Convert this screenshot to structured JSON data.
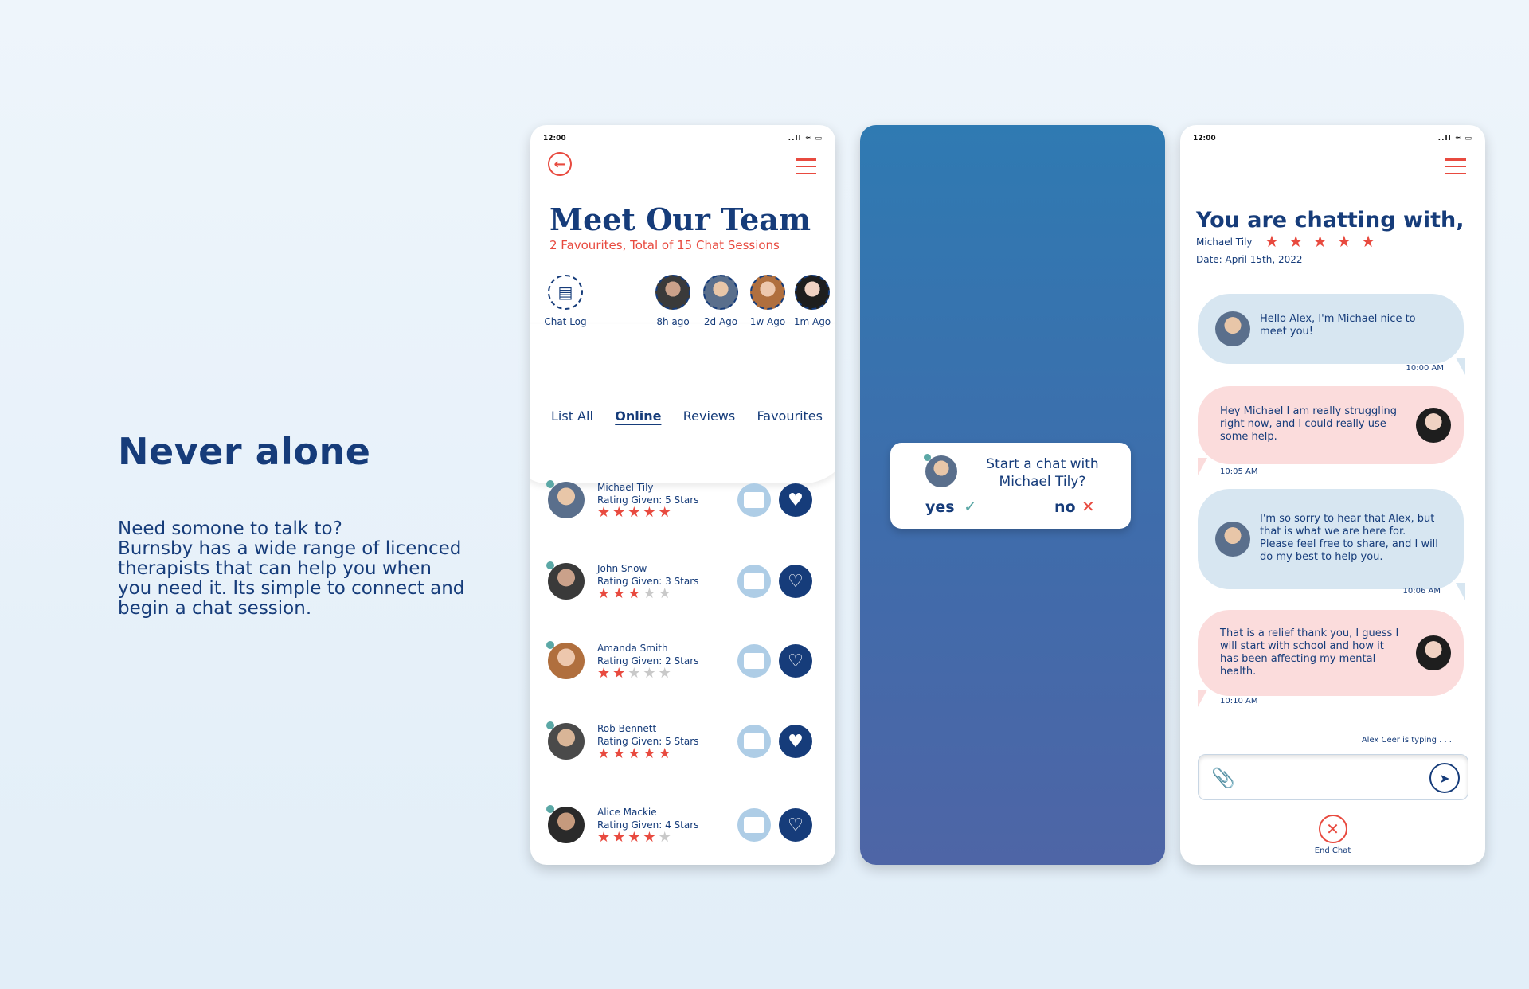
{
  "intro": {
    "heading": "Never alone",
    "body_lines": [
      "Need somone to talk to?",
      "Burnsby has a wide range of licenced",
      "therapists that can help you when",
      "you need it. Its simple to connect and",
      "begin a chat session."
    ]
  },
  "phone1": {
    "time": "12:00",
    "status_icons": "..ll ≈ ▭",
    "title": "Meet Our Team",
    "subtitle": "2 Favourites, Total of 15 Chat Sessions",
    "chat_log_label": "Chat Log",
    "recent": [
      {
        "label": "8h ago"
      },
      {
        "label": "2d Ago"
      },
      {
        "label": "1w Ago"
      },
      {
        "label": "1m Ago"
      }
    ],
    "tabs": [
      "List All",
      "Online",
      "Reviews",
      "Favourites"
    ],
    "active_tab": "Online",
    "therapists": [
      {
        "name": "Michael Tily",
        "rating": "Rating Given: 5 Stars",
        "stars": 5,
        "online": true,
        "favourite": true
      },
      {
        "name": "John Snow",
        "rating": "Rating Given: 3 Stars",
        "stars": 3,
        "online": true,
        "favourite": false
      },
      {
        "name": "Amanda Smith",
        "rating": "Rating Given: 2 Stars",
        "stars": 2,
        "online": true,
        "favourite": false
      },
      {
        "name": "Rob Bennett",
        "rating": "Rating Given: 5 Stars",
        "stars": 5,
        "online": true,
        "favourite": true
      },
      {
        "name": "Alice Mackie",
        "rating": "Rating Given: 4 Stars",
        "stars": 4,
        "online": true,
        "favourite": false
      }
    ]
  },
  "phone2": {
    "dialog_line1": "Start a chat with",
    "dialog_line2": "Michael Tily?",
    "yes_label": "yes",
    "no_label": "no"
  },
  "phone3": {
    "time": "12:00",
    "status_icons": "..ll ≈ ▭",
    "title": "You are chatting with,",
    "therapist": "Michael Tily",
    "stars": "★ ★ ★ ★ ★",
    "date": "Date: April 15th, 2022",
    "messages": [
      {
        "from": "therapist",
        "text": "Hello Alex, I'm Michael nice to meet you!",
        "time": "10:00 AM"
      },
      {
        "from": "user",
        "text": "Hey Michael I am really struggling right now, and I could really use some help.",
        "time": "10:05 AM"
      },
      {
        "from": "therapist",
        "text": "I'm so sorry to hear that Alex, but that is what we are here for. Please feel free to share, and I will do my best to help you.",
        "time": "10:06 AM"
      },
      {
        "from": "user",
        "text": "That is a relief thank you, I guess I will start with school and how it has been affecting my mental health.",
        "time": "10:10 AM"
      }
    ],
    "typing": "Alex Ceer is typing . . .",
    "end_chat_label": "End Chat"
  },
  "colors": {
    "navy": "#163c7a",
    "accent_red": "#e84a3f",
    "teal": "#5ba8a6",
    "bubble_blue": "#d7e6f1",
    "bubble_pink": "#fbdcdc"
  },
  "icons": {
    "back": "back-arrow-icon",
    "menu": "hamburger-menu-icon",
    "archive": "archive-box-icon",
    "chat": "chat-bubble-icon",
    "heart": "heart-icon",
    "check": "check-icon",
    "close": "close-icon",
    "attach": "paperclip-icon",
    "send": "send-icon"
  }
}
